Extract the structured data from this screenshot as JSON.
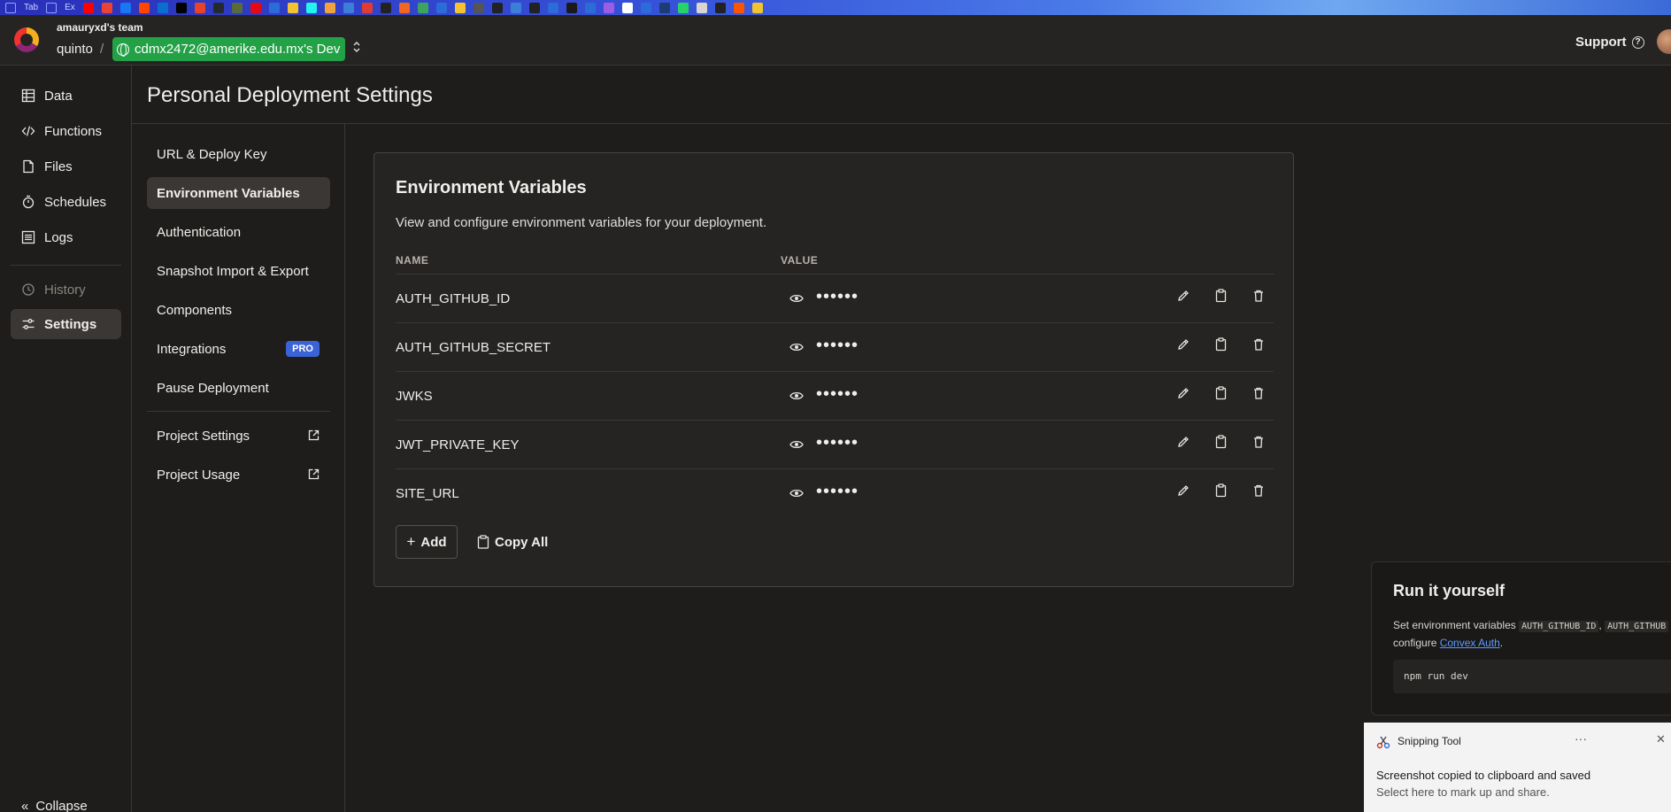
{
  "bookmarks": {
    "items": [
      "Tab",
      "Ex"
    ],
    "colors": [
      "#5577dd",
      "#5577dd",
      "#ff0000",
      "#ea4335",
      "#1877f2",
      "#ff4500",
      "#0b6fd0",
      "#000000",
      "#e8442a",
      "#24292e",
      "#5a6b3a",
      "#e50914",
      "#2c6cd8",
      "#f4c430",
      "#25f4ee",
      "#f0a33a",
      "#3b7fd8",
      "#e03c31",
      "#222222",
      "#f26522",
      "#3ba55d",
      "#2c6cd8",
      "#f4c430",
      "#555555",
      "#222222",
      "#3b7fd8",
      "#222222",
      "#2c6cd8",
      "#1a1a1a",
      "#2c6cd8",
      "#9b5de5",
      "#ffffff",
      "#2c6cd8",
      "#1f3b73",
      "#25d366",
      "#d8d5d1",
      "#222222",
      "#ff5500",
      "#f4c430"
    ]
  },
  "header": {
    "team_name": "amauryxd's team",
    "project": "quinto",
    "separator": "/",
    "deployment": "cdmx2472@amerike.edu.mx's Dev",
    "support_label": "Support",
    "help_glyph": "?",
    "switcher_glyph": "⌃⌄"
  },
  "nav": {
    "items": [
      {
        "label": "Data",
        "icon": "table-icon"
      },
      {
        "label": "Functions",
        "icon": "code-icon"
      },
      {
        "label": "Files",
        "icon": "file-icon"
      },
      {
        "label": "Schedules",
        "icon": "stopwatch-icon"
      },
      {
        "label": "Logs",
        "icon": "list-icon"
      },
      {
        "label": "History",
        "icon": "history-icon"
      },
      {
        "label": "Settings",
        "icon": "sliders-icon"
      }
    ],
    "collapse_label": "Collapse",
    "collapse_glyph": "«"
  },
  "page": {
    "title": "Personal Deployment Settings"
  },
  "settings_nav": {
    "items": [
      {
        "label": "URL & Deploy Key"
      },
      {
        "label": "Environment Variables"
      },
      {
        "label": "Authentication"
      },
      {
        "label": "Snapshot Import & Export"
      },
      {
        "label": "Components"
      },
      {
        "label": "Integrations",
        "badge": "PRO"
      },
      {
        "label": "Pause Deployment"
      },
      {
        "label": "Project Settings"
      },
      {
        "label": "Project Usage"
      }
    ]
  },
  "env": {
    "title": "Environment Variables",
    "description": "View and configure environment variables for your deployment.",
    "col_name": "NAME",
    "col_value": "VALUE",
    "rows": [
      {
        "name": "AUTH_GITHUB_ID",
        "masked": "••••••"
      },
      {
        "name": "AUTH_GITHUB_SECRET",
        "masked": "••••••"
      },
      {
        "name": "JWKS",
        "masked": "••••••"
      },
      {
        "name": "JWT_PRIVATE_KEY",
        "masked": "••••••"
      },
      {
        "name": "SITE_URL",
        "masked": "••••••"
      }
    ],
    "add_label": "Add",
    "add_glyph": "+",
    "copy_all_label": "Copy All"
  },
  "run_panel": {
    "title": "Run it yourself",
    "text_prefix": "Set environment variables",
    "var1": "AUTH_GITHUB_ID",
    "var_sep": ",",
    "var2": "AUTH_GITHUB",
    "line2_prefix": "configure",
    "link": "Convex Auth",
    "line2_suffix": ".",
    "command": "npm run dev"
  },
  "toast": {
    "app": "Snipping Tool",
    "more_glyph": "···",
    "close_glyph": "✕",
    "message": "Screenshot copied to clipboard and saved",
    "sub": "Select here to mark up and share."
  },
  "colors": {
    "deployment_green": "#23a146",
    "pro_badge": "#3a63d8",
    "link_blue": "#5b9bff"
  }
}
